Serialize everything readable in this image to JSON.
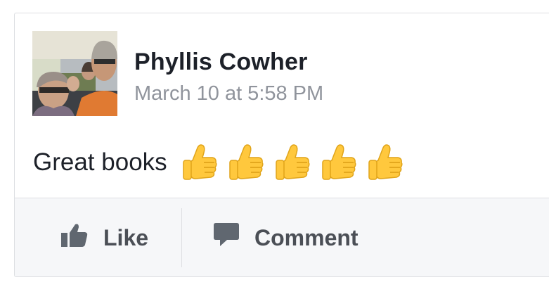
{
  "post": {
    "author": "Phyllis Cowher",
    "timestamp": "March 10 at 5:58 PM",
    "text": "Great books",
    "emoji_name": "thumbs-up-icon",
    "emoji_count": 5
  },
  "actions": {
    "like_label": "Like",
    "like_icon": "thumbs-up-icon",
    "comment_label": "Comment",
    "comment_icon": "speech-bubble-icon"
  },
  "colors": {
    "author": "#1d2129",
    "timestamp": "#90949c",
    "action_text": "#4b4f56",
    "action_bar_bg": "#f6f7f9",
    "emoji": "#ffc83d"
  }
}
